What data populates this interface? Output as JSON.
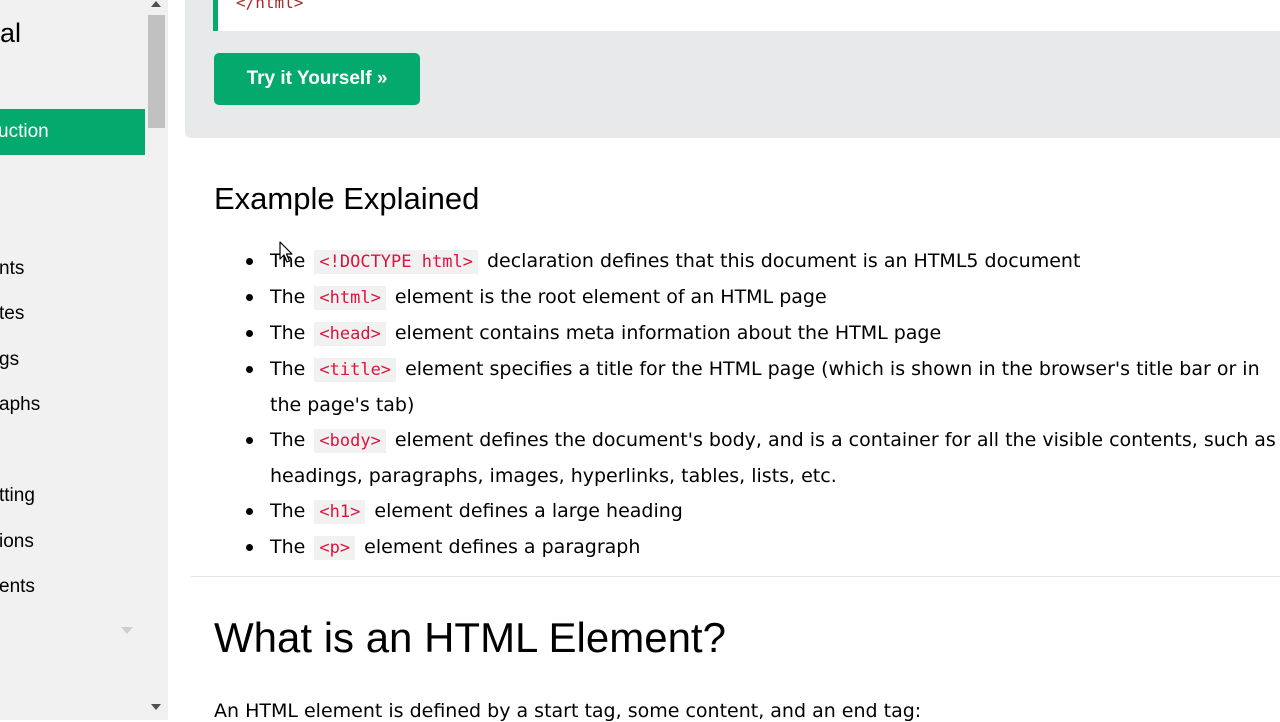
{
  "sidebar": {
    "title_fragment": "ial",
    "active_item": "uction",
    "items": [
      "nts",
      "tes",
      "gs",
      "aphs",
      "tting",
      "ions",
      "ents"
    ]
  },
  "example": {
    "code_last_line": "</html>",
    "try_button": "Try it Yourself »"
  },
  "explained": {
    "heading": "Example Explained",
    "items": [
      {
        "before": "The",
        "tag": "<!DOCTYPE html>",
        "after": "declaration defines that this document is an HTML5 document"
      },
      {
        "before": "The",
        "tag": "<html>",
        "after": "element is the root element of an HTML page"
      },
      {
        "before": "The",
        "tag": "<head>",
        "after": "element contains meta information about the HTML page"
      },
      {
        "before": "The",
        "tag": "<title>",
        "after": "element specifies a title for the HTML page (which is shown in the browser's title bar or in",
        "continuation": "the page's tab)"
      },
      {
        "before": "The",
        "tag": "<body>",
        "after": "element defines the document's body, and is a container for all the visible contents, such as",
        "continuation": "headings, paragraphs, images, hyperlinks, tables, lists, etc."
      },
      {
        "before": "The",
        "tag": "<h1>",
        "after": "element defines a large heading"
      },
      {
        "before": "The",
        "tag": "<p>",
        "after": "element defines a paragraph"
      }
    ]
  },
  "element_section": {
    "heading": "What is an HTML Element?",
    "intro": "An HTML element is defined by a start tag, some content, and an end tag:"
  },
  "colors": {
    "accent": "#04aa6d",
    "sidebar_bg": "#f1f1f1",
    "example_bg": "#e7e9eb",
    "tag_color": "#dc143c",
    "code_color": "#a52a2a"
  },
  "icons": [
    "scroll-up-icon",
    "scroll-down-icon",
    "chevron-down-icon",
    "mouse-cursor-icon"
  ]
}
